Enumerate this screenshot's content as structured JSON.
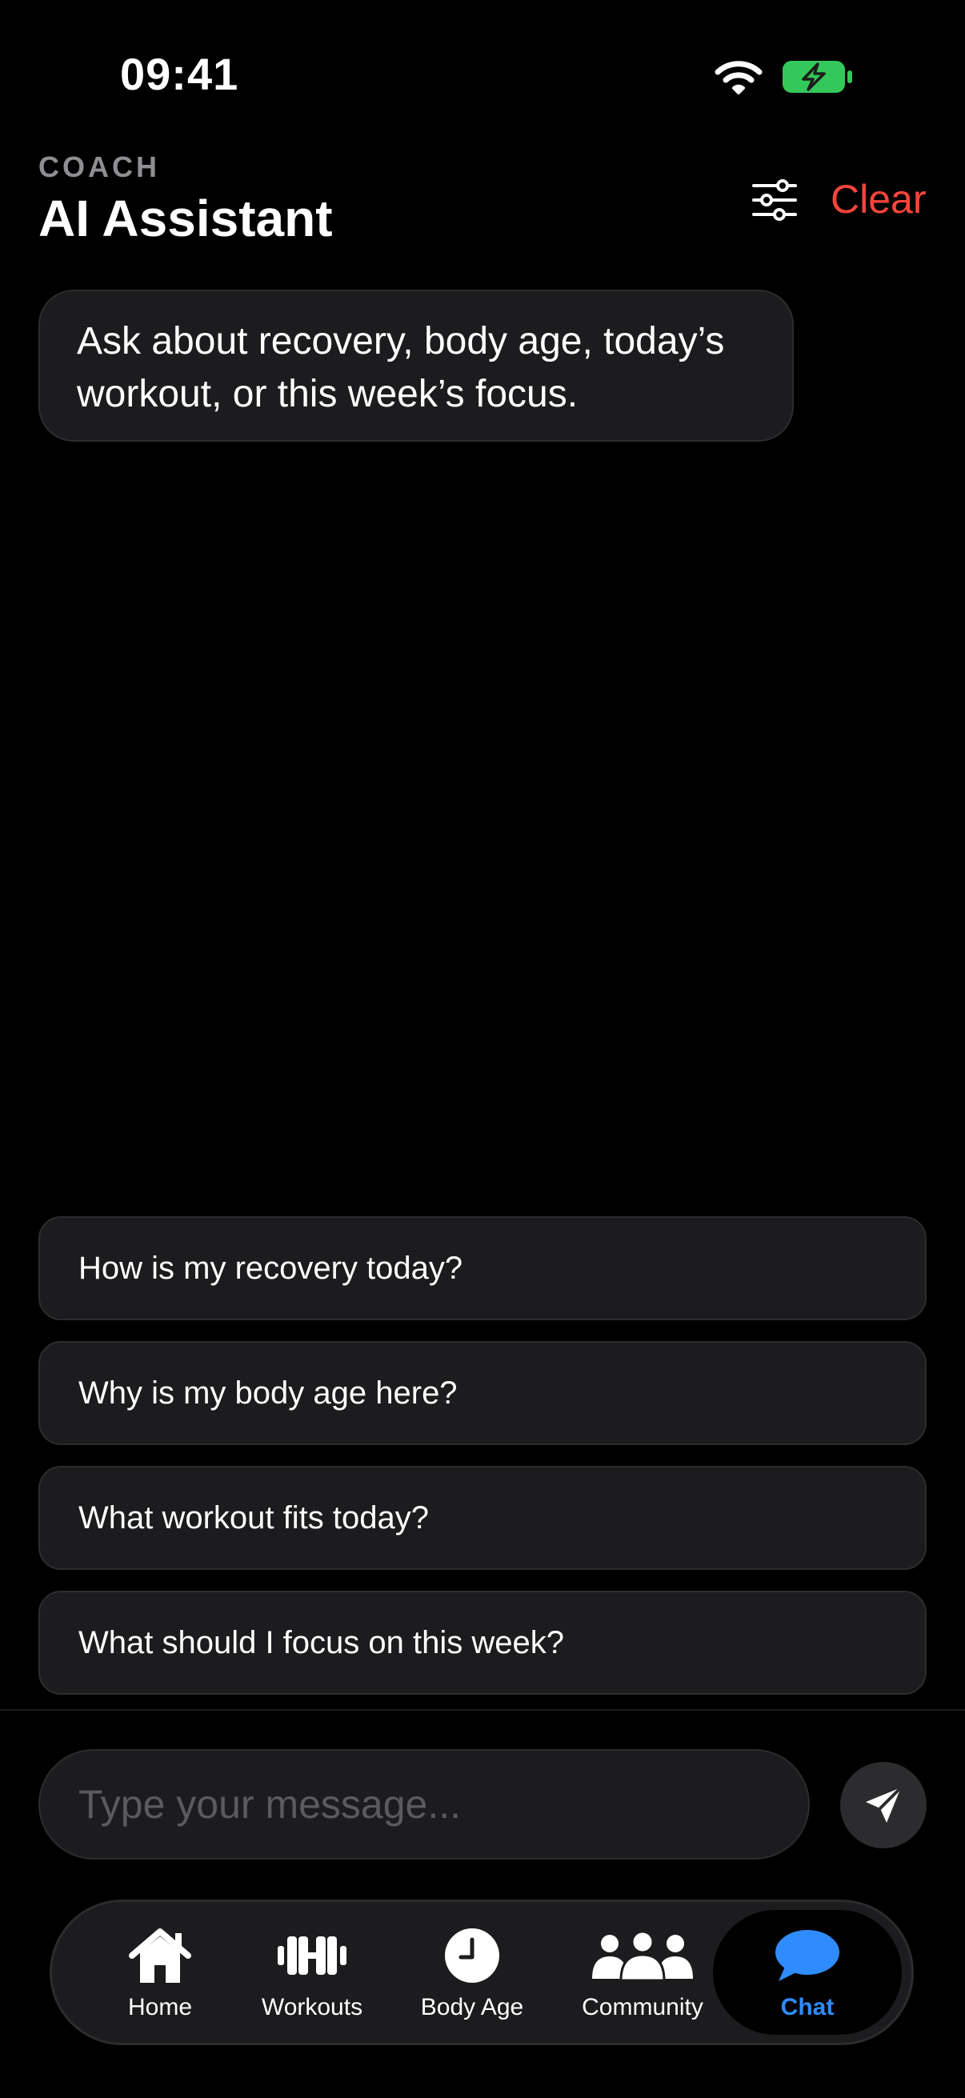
{
  "status_bar": {
    "time": "09:41"
  },
  "header": {
    "eyebrow": "COACH",
    "title": "AI Assistant",
    "clear_label": "Clear"
  },
  "assistant": {
    "message": "Ask about recovery, body age, today’s workout, or this week’s focus."
  },
  "suggestions": [
    "How is my recovery today?",
    "Why is my body age here?",
    "What workout fits today?",
    "What should I focus on this week?"
  ],
  "composer": {
    "placeholder": "Type your message..."
  },
  "tabs": [
    {
      "label": "Home",
      "icon": "house-icon"
    },
    {
      "label": "Workouts",
      "icon": "dumbbell-icon"
    },
    {
      "label": "Body Age",
      "icon": "clock-icon"
    },
    {
      "label": "Community",
      "icon": "people-icon"
    },
    {
      "label": "Chat",
      "icon": "chat-bubble-icon",
      "active": true
    }
  ],
  "colors": {
    "background": "#000000",
    "surface": "#1c1c1e",
    "accent_red": "#ff453a",
    "accent_blue": "#2f8cff",
    "battery_green": "#34c759"
  }
}
